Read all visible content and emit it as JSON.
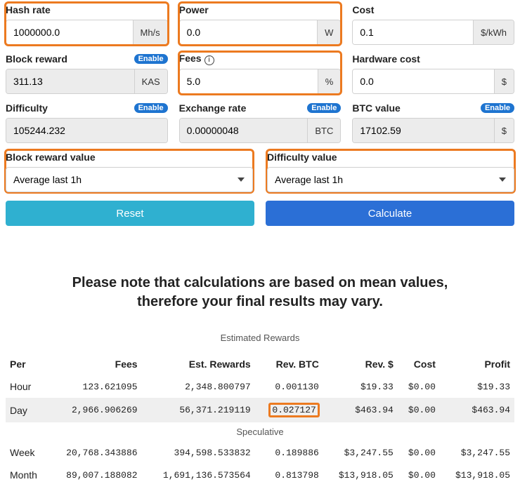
{
  "inputs": {
    "hashrate": {
      "label": "Hash rate",
      "value": "1000000.0",
      "suffix": "Mh/s"
    },
    "power": {
      "label": "Power",
      "value": "0.0",
      "suffix": "W"
    },
    "cost": {
      "label": "Cost",
      "value": "0.1",
      "suffix": "$/kWh"
    },
    "block": {
      "label": "Block reward",
      "value": "311.13",
      "suffix": "KAS",
      "enable": "Enable"
    },
    "fees": {
      "label": "Fees",
      "value": "5.0",
      "suffix": "%"
    },
    "hardware": {
      "label": "Hardware cost",
      "value": "0.0",
      "suffix": "$"
    },
    "diff": {
      "label": "Difficulty",
      "value": "105244.232",
      "enable": "Enable"
    },
    "exrate": {
      "label": "Exchange rate",
      "value": "0.00000048",
      "suffix": "BTC",
      "enable": "Enable"
    },
    "btcval": {
      "label": "BTC value",
      "value": "17102.59",
      "suffix": "$",
      "enable": "Enable"
    }
  },
  "selects": {
    "blockreward": {
      "label": "Block reward value",
      "value": "Average last 1h"
    },
    "diffvalue": {
      "label": "Difficulty value",
      "value": "Average last 1h"
    }
  },
  "buttons": {
    "reset": "Reset",
    "calculate": "Calculate"
  },
  "note": {
    "l1": "Please note that calculations are based on mean values,",
    "l2": "therefore your final results may vary."
  },
  "table": {
    "title": "Estimated Rewards",
    "head": {
      "per": "Per",
      "fees": "Fees",
      "est": "Est. Rewards",
      "rbtc": "Rev. BTC",
      "rusd": "Rev. $",
      "cost": "Cost",
      "profit": "Profit"
    },
    "rows": [
      {
        "per": "Hour",
        "fees": "123.621095",
        "est": "2,348.800797",
        "rbtc": "0.001130",
        "rusd": "$19.33",
        "cost": "$0.00",
        "profit": "$19.33"
      },
      {
        "per": "Day",
        "fees": "2,966.906269",
        "est": "56,371.219119",
        "rbtc": "0.027127",
        "rusd": "$463.94",
        "cost": "$0.00",
        "profit": "$463.94"
      }
    ],
    "spec_label": "Speculative",
    "spec_rows": [
      {
        "per": "Week",
        "fees": "20,768.343886",
        "est": "394,598.533832",
        "rbtc": "0.189886",
        "rusd": "$3,247.55",
        "cost": "$0.00",
        "profit": "$3,247.55"
      },
      {
        "per": "Month",
        "fees": "89,007.188082",
        "est": "1,691,136.573564",
        "rbtc": "0.813798",
        "rusd": "$13,918.05",
        "cost": "$0.00",
        "profit": "$13,918.05"
      }
    ]
  }
}
